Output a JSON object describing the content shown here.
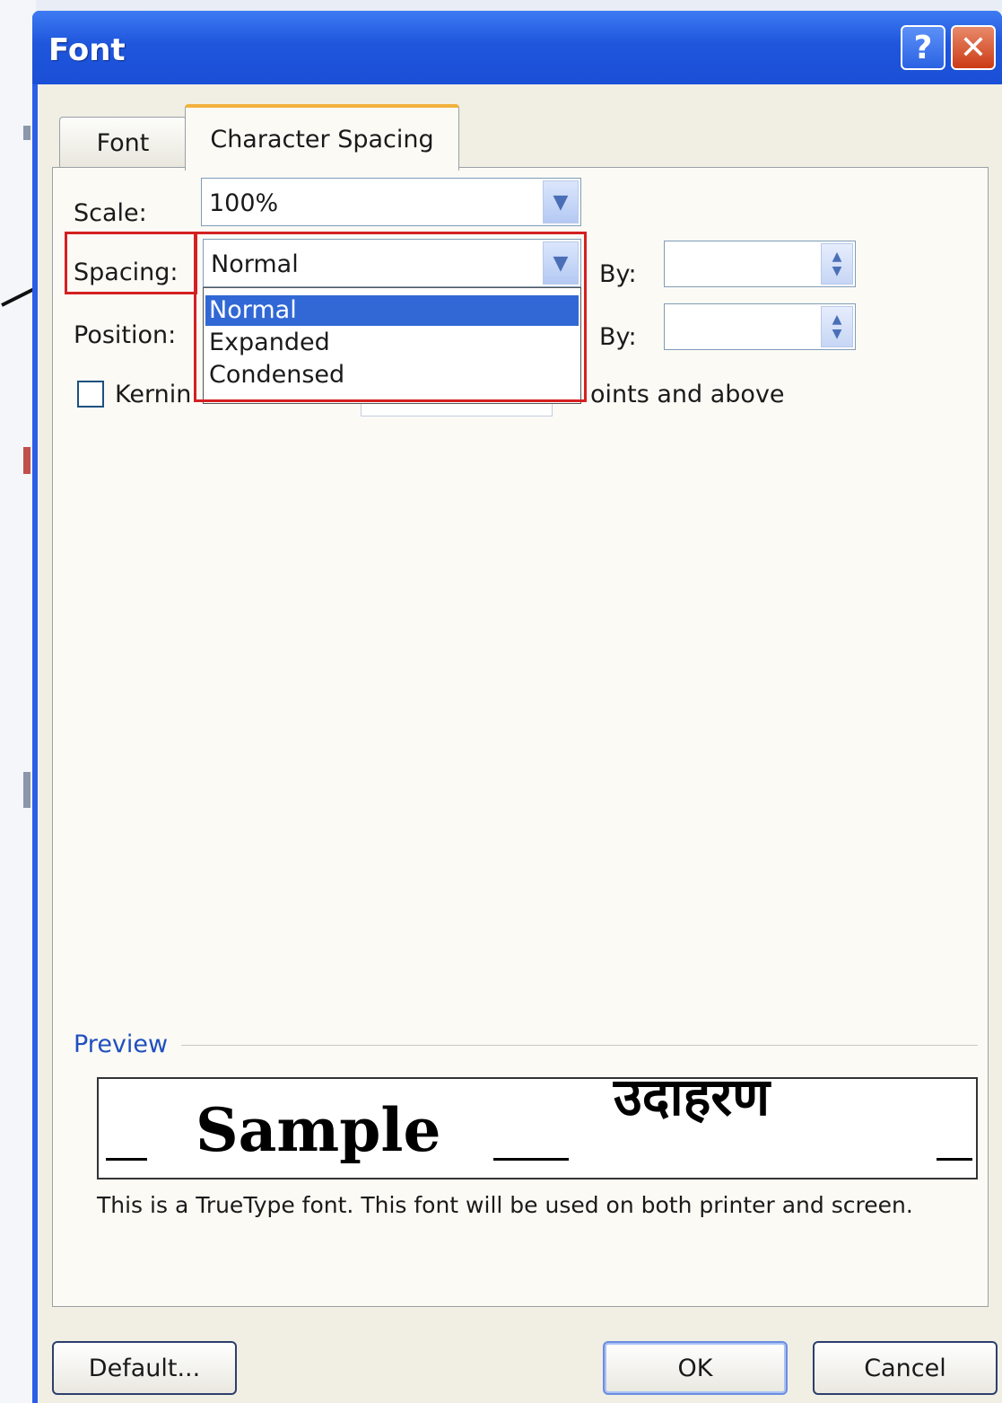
{
  "dialog": {
    "title": "Font",
    "help_glyph": "?",
    "close_glyph": "✕"
  },
  "tabs": [
    {
      "label": "Font",
      "active": false
    },
    {
      "label": "Character Spacing",
      "active": true
    }
  ],
  "scale": {
    "label": "Scale:",
    "value": "100%"
  },
  "spacing": {
    "label": "Spacing:",
    "value": "Normal",
    "by_label": "By:",
    "options": [
      "Normal",
      "Expanded",
      "Condensed"
    ],
    "selected_index": 0
  },
  "position": {
    "label": "Position:",
    "by_label": "By:"
  },
  "kerning": {
    "label_start": "Kernin",
    "label_end": "oints and above",
    "checked": false
  },
  "preview": {
    "heading": "Preview",
    "sample_text": "Sample",
    "deva_text": "उदाहरण",
    "note": "This is a TrueType font. This font will be used on both printer and screen."
  },
  "buttons": {
    "default": "Default...",
    "ok": "OK",
    "cancel": "Cancel"
  },
  "colors": {
    "title_bar": "#1f56dc",
    "highlight": "#d42020",
    "selection": "#3168d5",
    "tab_accent": "#f2b13c"
  },
  "icons": {
    "combo_arrow": "chevron-down-icon",
    "spinner": "spinner-icon",
    "pointer": "arrow-pointer-icon"
  }
}
